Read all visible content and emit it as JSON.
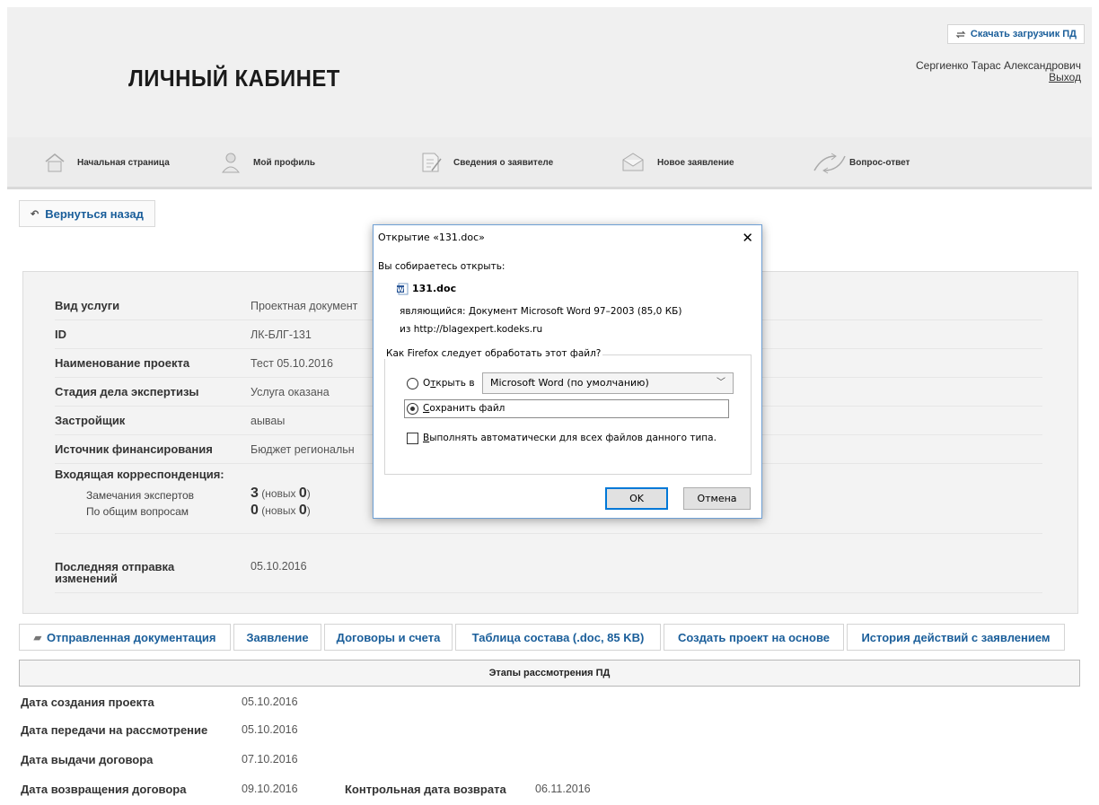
{
  "header": {
    "title": "ЛИЧНЫЙ КАБИНЕТ",
    "download_label": "Скачать загрузчик ПД",
    "user_name": "Сергиенко Тарас Александрович",
    "logout": "Выход"
  },
  "nav": {
    "items": [
      {
        "label": "Начальная страница",
        "icon": "home-icon"
      },
      {
        "label": "Мой профиль",
        "icon": "user-icon"
      },
      {
        "label": "Сведения о заявителе",
        "icon": "document-edit-icon"
      },
      {
        "label": "Новое заявление",
        "icon": "envelope-icon"
      },
      {
        "label": "Вопрос-ответ",
        "icon": "arrows-icon"
      }
    ]
  },
  "back_label": "Вернуться назад",
  "info": {
    "service_label": "Вид услуги",
    "service_value": "Проектная документ",
    "id_label": "ID",
    "id_value": "ЛК-БЛГ-131",
    "project_label": "Наименование проекта",
    "project_value": "Тест 05.10.2016",
    "stage_label": "Стадия дела экспертизы",
    "stage_value": "Услуга оказана",
    "developer_label": "Застройщик",
    "developer_value": "аываы",
    "funding_label": "Источник финансирования",
    "funding_value": "Бюджет региональн",
    "incoming_label": "Входящая корреспонденция:",
    "remarks_label": "Замечания экспертов",
    "remarks_count": "3",
    "remarks_new": "0",
    "general_label": "По общим вопросам",
    "general_count": "0",
    "general_new": "0",
    "new_word_open": "(новых ",
    "new_word_close": ")",
    "last_sent_label": "Последняя отправка изменений",
    "last_sent_value": "05.10.2016"
  },
  "tabs": [
    "Отправленная документация",
    "Заявление",
    "Договоры и счета",
    "Таблица состава (.doc, 85 KB)",
    "Создать проект на основе",
    "История действий с заявлением"
  ],
  "stages": {
    "title": "Этапы рассмотрения ПД",
    "rows": [
      {
        "label": "Дата создания проекта",
        "value": "05.10.2016"
      },
      {
        "label": "Дата передачи на рассмотрение",
        "value": "05.10.2016"
      },
      {
        "label": "Дата выдачи договора",
        "value": "07.10.2016"
      },
      {
        "label": "Дата возвращения договора",
        "value": "09.10.2016",
        "extra_label": "Контрольная дата возврата",
        "extra_value": "06.11.2016"
      }
    ]
  },
  "dialog": {
    "title": "Открытие «131.doc»",
    "intro": "Вы собираетесь открыть:",
    "file_name": "131.doc",
    "type_label": "являющийся:",
    "type_value": "Документ Microsoft Word 97–2003 (85,0 КБ)",
    "from_label": "из",
    "from_value": "http://blagexpert.kodeks.ru",
    "question": "Как Firefox следует обработать этот файл?",
    "open_with_pre": "О",
    "open_with_acc": "т",
    "open_with_post": "крыть в",
    "app_value": "Microsoft Word (по умолчанию)",
    "save_acc": "С",
    "save_post": "охранить файл",
    "auto_acc": "В",
    "auto_post": "ыполнять автоматически для всех файлов данного типа.",
    "ok": "OK",
    "cancel": "Отмена"
  }
}
